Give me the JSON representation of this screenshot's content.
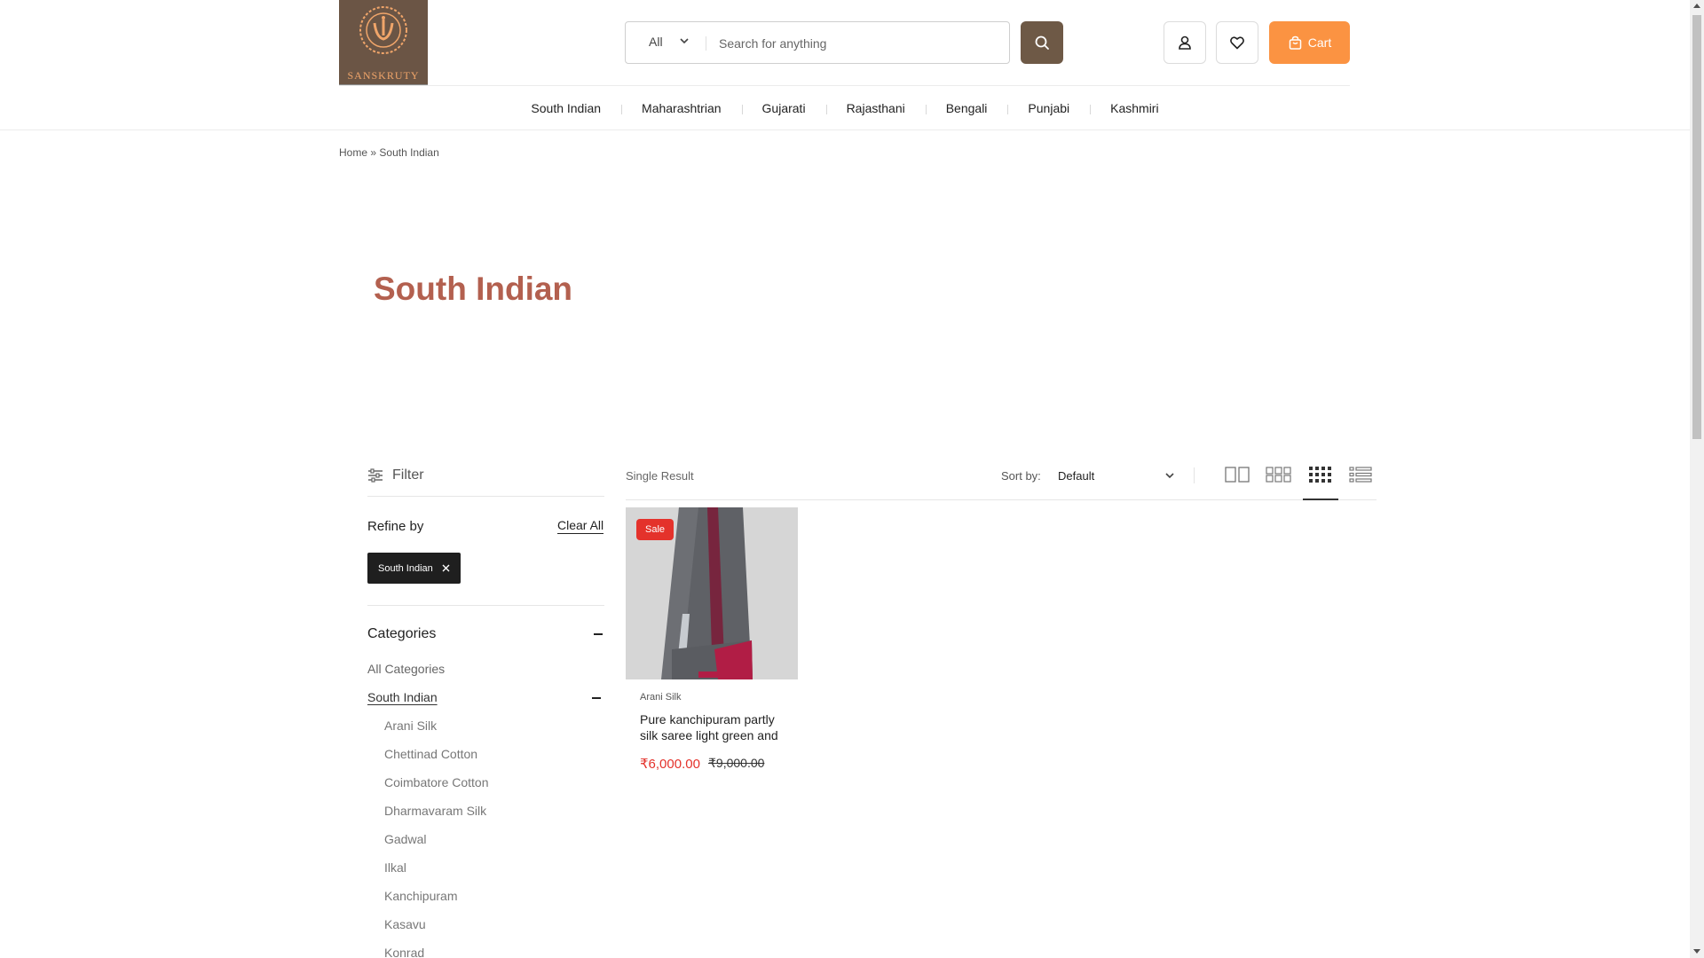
{
  "brand": {
    "name": "SANSKRUTY",
    "logo_color": "#6b5545",
    "accent": "#fb9342",
    "title_color": "#b3604f",
    "sale_color": "#e4322b"
  },
  "header": {
    "search": {
      "category": "All",
      "placeholder": "Search for anything"
    },
    "cart_label": "Cart",
    "icons": [
      "search-icon",
      "user-icon",
      "heart-icon",
      "shopping-bag-icon"
    ]
  },
  "nav": {
    "items": [
      "South Indian",
      "Maharashtrian",
      "Gujarati",
      "Rajasthani",
      "Bengali",
      "Punjabi",
      "Kashmiri"
    ]
  },
  "breadcrumb": {
    "home": "Home",
    "separator": "»",
    "current": "South Indian"
  },
  "page_title": "South Indian",
  "sidebar": {
    "filter_label": "Filter",
    "refine_title": "Refine by",
    "clear_all": "Clear All",
    "active_filter": "South Indian",
    "categories_title": "Categories",
    "all_categories": "All Categories",
    "active_category": "South Indian",
    "subcategories": [
      "Arani Silk",
      "Chettinad Cotton",
      "Coimbatore Cotton",
      "Dharmavaram Silk",
      "Gadwal",
      "Ilkal",
      "Kanchipuram",
      "Kasavu",
      "Konrad"
    ]
  },
  "toolbar": {
    "result_count": "Single Result",
    "sort_label": "Sort by:",
    "sort_value": "Default",
    "views": [
      "two-column-view-icon",
      "three-column-view-icon",
      "four-column-view-icon",
      "list-view-icon"
    ],
    "active_view": "four-column-view-icon"
  },
  "products": [
    {
      "badge": "Sale",
      "category": "Arani Silk",
      "name": "Pure kanchipuram partly silk saree light green and",
      "price": "₹6,000.00",
      "original_price": "₹9,000.00"
    }
  ]
}
